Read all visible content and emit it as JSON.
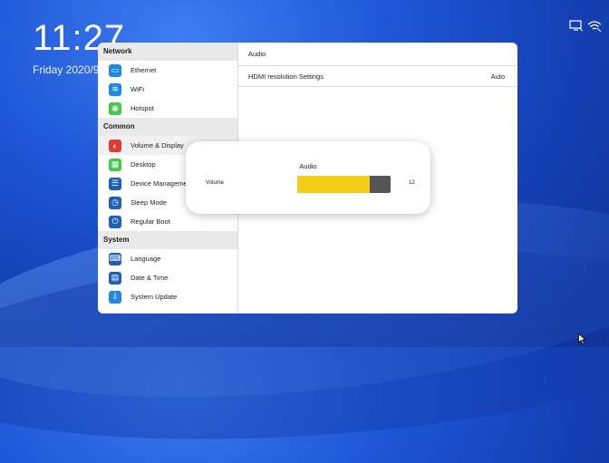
{
  "clock": {
    "time": "11:27",
    "date": "Friday 2020/9/"
  },
  "sidebar": {
    "sections": [
      {
        "header": "Network",
        "items": [
          {
            "label": "Ethernet",
            "icon": "ethernet-icon",
            "color": "#1e88e5"
          },
          {
            "label": "WiFi",
            "icon": "wifi-icon",
            "color": "#1e88e5"
          },
          {
            "label": "Hotspot",
            "icon": "hotspot-icon",
            "color": "#43c84a"
          }
        ]
      },
      {
        "header": "Common",
        "items": [
          {
            "label": "Volume & Display",
            "icon": "volume-display-icon",
            "color": "#e53935"
          },
          {
            "label": "Desktop",
            "icon": "desktop-icon",
            "color": "#43c84a"
          },
          {
            "label": "Device Manageme",
            "icon": "device-management-icon",
            "color": "#1e5fb8"
          },
          {
            "label": "Sleep Mode",
            "icon": "sleep-mode-icon",
            "color": "#1e5fb8"
          },
          {
            "label": "Regular Boot",
            "icon": "regular-boot-icon",
            "color": "#1e5fb8"
          }
        ]
      },
      {
        "header": "System",
        "items": [
          {
            "label": "Language",
            "icon": "language-icon",
            "color": "#1e5fb8"
          },
          {
            "label": "Date & Time",
            "icon": "date-time-icon",
            "color": "#1e5fb8"
          },
          {
            "label": "System Update",
            "icon": "system-update-icon",
            "color": "#1e88e5"
          }
        ]
      }
    ]
  },
  "content": {
    "rows": [
      {
        "label": "Audio",
        "value": ""
      },
      {
        "label": "HDMI resolution Settings",
        "value": "Auto"
      }
    ]
  },
  "dialog": {
    "title": "Audio",
    "volume_label": "Volume",
    "volume_value": "12",
    "volume_fraction": 0.78,
    "fill_color": "#f5cc18"
  }
}
